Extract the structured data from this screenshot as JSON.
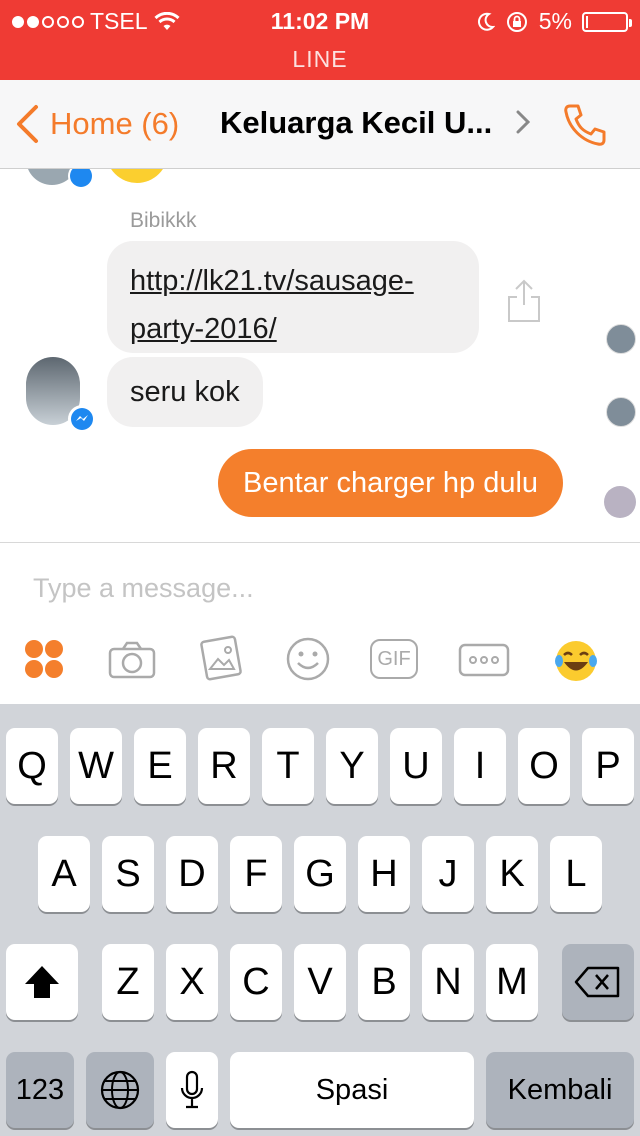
{
  "status_bar": {
    "carrier": "TSEL",
    "time": "11:02 PM",
    "battery": "5%",
    "battery_level": 0.05,
    "app_label": "LINE"
  },
  "nav": {
    "back_label": "Home (6)",
    "title": "Keluarga Kecil U...",
    "colors": {
      "accent": "#f47b2b"
    }
  },
  "chat": {
    "sender_name": "Bibikkk",
    "messages": [
      {
        "direction": "incoming",
        "type": "link",
        "text": "http://lk21.tv/sausage-party-2016/"
      },
      {
        "direction": "incoming",
        "type": "text",
        "text": "seru kok"
      },
      {
        "direction": "outgoing",
        "type": "text",
        "text": "Bentar charger hp dulu"
      }
    ]
  },
  "composer": {
    "placeholder": "Type a message...",
    "tools": [
      "stickers-icon",
      "camera-icon",
      "gallery-icon",
      "emoji-icon",
      "gif-icon",
      "more-icon",
      "laughing-emoji-icon"
    ],
    "gif_label": "GIF"
  },
  "keyboard": {
    "rows": [
      [
        "Q",
        "W",
        "E",
        "R",
        "T",
        "Y",
        "U",
        "I",
        "O",
        "P"
      ],
      [
        "A",
        "S",
        "D",
        "F",
        "G",
        "H",
        "J",
        "K",
        "L"
      ],
      [
        "Z",
        "X",
        "C",
        "V",
        "B",
        "N",
        "M"
      ]
    ],
    "numbers_label": "123",
    "space_label": "Spasi",
    "return_label": "Kembali"
  }
}
